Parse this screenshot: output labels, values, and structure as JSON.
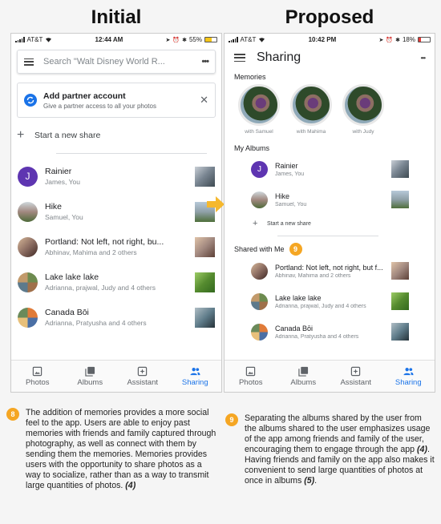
{
  "headings": {
    "initial": "Initial",
    "proposed": "Proposed"
  },
  "colors": {
    "accent": "#1a73e8",
    "badge": "#f5a623",
    "arrow": "#f5b82e"
  },
  "initial": {
    "status": {
      "carrier": "AT&T",
      "time": "12:44 AM",
      "battery": "55%"
    },
    "search": {
      "placeholder": "Search \"Walt Disney World R...",
      "menu_icon": "hamburger-icon",
      "more_icon": "more-dots-icon"
    },
    "partner": {
      "title": "Add partner account",
      "subtitle": "Give a partner access to all your photos",
      "icon": "partner-sync-icon",
      "close_icon": "close-icon"
    },
    "new_share": {
      "plus": "+",
      "label": "Start a new share"
    },
    "albums": [
      {
        "title": "Rainier",
        "subtitle": "James, You",
        "avatar_letter": "J"
      },
      {
        "title": "Hike",
        "subtitle": "Samuel, You"
      },
      {
        "title": "Portland: Not left, not right, bu...",
        "subtitle": "Abhinav, Mahima and 2 others"
      },
      {
        "title": "Lake lake lake",
        "subtitle": "Adrianna, prajwal, Judy and 4 others"
      },
      {
        "title": "Canada Bōi",
        "subtitle": "Adrianna, Pratyusha and 4 others"
      }
    ]
  },
  "proposed": {
    "status": {
      "carrier": "AT&T",
      "time": "10:42 PM",
      "battery": "18%"
    },
    "title": "Sharing",
    "memories_label": "Memories",
    "memories": [
      {
        "label": "with Samuel"
      },
      {
        "label": "with Mahima"
      },
      {
        "label": "with Judy"
      }
    ],
    "my_albums_label": "My Albums",
    "my_albums": [
      {
        "title": "Rainier",
        "subtitle": "James, You",
        "avatar_letter": "J"
      },
      {
        "title": "Hike",
        "subtitle": "Samuel, You"
      }
    ],
    "new_share": {
      "plus": "+",
      "label": "Start a new share"
    },
    "shared_label": "Shared with Me",
    "shared_badge": "9",
    "shared": [
      {
        "title": "Portland: Not left, not right, but f...",
        "subtitle": "Abhinav, Mahima and 2 others"
      },
      {
        "title": "Lake lake lake",
        "subtitle": "Adrianna, prajwal, Judy and 4 others"
      },
      {
        "title": "Canada Bōi",
        "subtitle": "Adrianna, Pratyusha and 4 others"
      }
    ]
  },
  "nav": [
    {
      "label": "Photos",
      "icon": "photo-icon"
    },
    {
      "label": "Albums",
      "icon": "albums-icon"
    },
    {
      "label": "Assistant",
      "icon": "assistant-icon"
    },
    {
      "label": "Sharing",
      "icon": "sharing-people-icon"
    }
  ],
  "notes": {
    "left": {
      "badge": "8",
      "text": "The addition of memories provides a more social feel to the app. Users are able to enjoy past memories with friends and family captured through photography, as well as connect with them by sending them the memories. Memories provides users with the opportunity to share photos as a way to socialize, rather than as a way to transmit large quantities of photos.",
      "cite": "(4)"
    },
    "right": {
      "badge": "9",
      "text1": "Separating the albums shared by the user from the albums shared to the user emphasizes usage of the app among friends and family of the user, encouraging them to engage through the app",
      "cite1": "(4)",
      "text2": ". Having friends and family on the app also makes it convenient to send large quantities of photos at once in albums",
      "cite2": "(5)",
      "end": "."
    }
  }
}
